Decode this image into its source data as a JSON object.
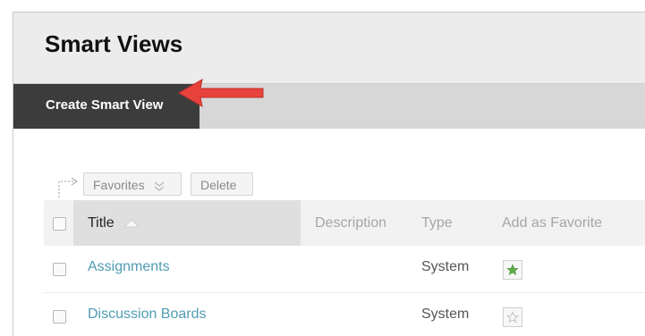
{
  "page": {
    "title": "Smart Views"
  },
  "actionbar": {
    "create_label": "Create Smart View"
  },
  "toolbar": {
    "favorites_label": "Favorites",
    "delete_label": "Delete"
  },
  "table": {
    "columns": {
      "title": "Title",
      "description": "Description",
      "type": "Type",
      "favorite": "Add as Favorite"
    },
    "rows": [
      {
        "title": "Assignments",
        "description": "",
        "type": "System",
        "favorite": true
      },
      {
        "title": "Discussion Boards",
        "description": "",
        "type": "System",
        "favorite": false
      }
    ]
  },
  "colors": {
    "favorite_star": "#5fae48",
    "inactive_star": "#bdbdbd",
    "link": "#4f9db3",
    "arrow": "#e8423c"
  },
  "icons": [
    "select-all-arrow-icon",
    "chevron-down-icon",
    "sort-ascending-icon",
    "star-icon"
  ]
}
